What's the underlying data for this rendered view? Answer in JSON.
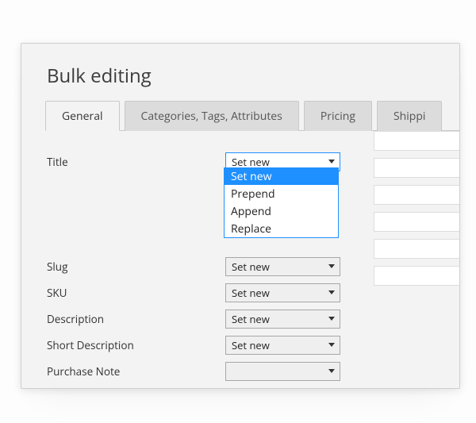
{
  "title": "Bulk editing",
  "tabs": [
    {
      "label": "General",
      "active": true
    },
    {
      "label": "Categories, Tags, Attributes",
      "active": false
    },
    {
      "label": "Pricing",
      "active": false
    },
    {
      "label": "Shippi",
      "active": false
    }
  ],
  "titleField": {
    "label": "Title",
    "selected": "Set new",
    "options": [
      "Set new",
      "Prepend",
      "Append",
      "Replace"
    ]
  },
  "rows": [
    {
      "label": "Slug",
      "selected": "Set new"
    },
    {
      "label": "SKU",
      "selected": "Set new"
    },
    {
      "label": "Description",
      "selected": "Set new"
    },
    {
      "label": "Short Description",
      "selected": "Set new"
    },
    {
      "label": "Purchase Note",
      "selected": ""
    }
  ],
  "textboxCount": 6
}
